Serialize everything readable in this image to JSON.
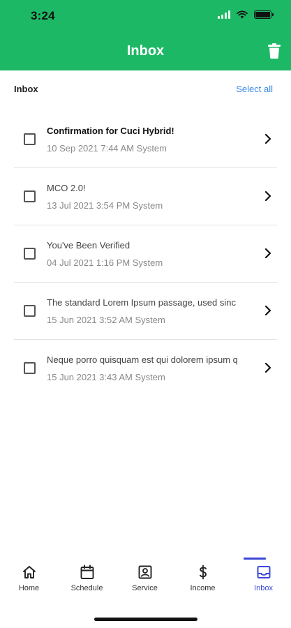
{
  "status": {
    "time": "3:24"
  },
  "header": {
    "title": "Inbox"
  },
  "section": {
    "label": "Inbox",
    "select_all": "Select all"
  },
  "messages": [
    {
      "title": "Confirmation for Cuci Hybrid!",
      "meta": "10 Sep 2021 7:44 AM System",
      "unread": true
    },
    {
      "title": "MCO 2.0!",
      "meta": "13 Jul 2021 3:54 PM System",
      "unread": false
    },
    {
      "title": "You've Been Verified",
      "meta": "04 Jul 2021 1:16 PM System",
      "unread": false
    },
    {
      "title": "The standard Lorem Ipsum passage, used sinc",
      "meta": "15 Jun 2021 3:52 AM System",
      "unread": false
    },
    {
      "title": "Neque porro quisquam est qui dolorem ipsum q",
      "meta": "15 Jun 2021 3:43 AM System",
      "unread": false
    }
  ],
  "tabs": [
    {
      "label": "Home",
      "icon": "home-icon"
    },
    {
      "label": "Schedule",
      "icon": "calendar-icon"
    },
    {
      "label": "Service",
      "icon": "portrait-icon"
    },
    {
      "label": "Income",
      "icon": "dollar-icon"
    },
    {
      "label": "Inbox",
      "icon": "inbox-icon",
      "active": true
    }
  ],
  "colors": {
    "header": "#1db866",
    "accent": "#3a87e6",
    "active_tab": "#3b48d6"
  }
}
